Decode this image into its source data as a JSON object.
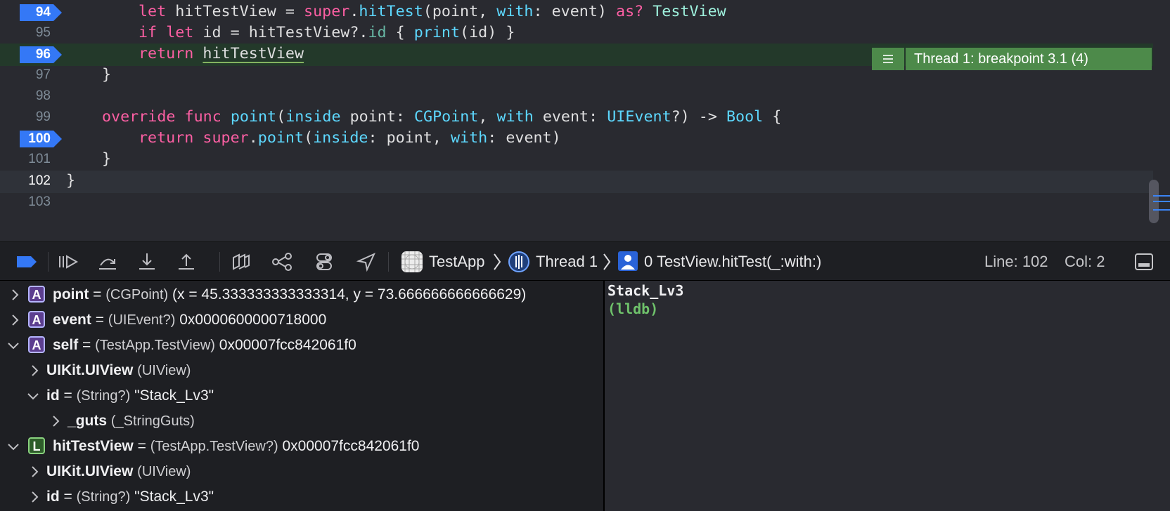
{
  "editor": {
    "lines": [
      {
        "num": "94",
        "breakpoint": true
      },
      {
        "num": "95",
        "breakpoint": false
      },
      {
        "num": "96",
        "breakpoint": true
      },
      {
        "num": "97",
        "breakpoint": false
      },
      {
        "num": "98",
        "breakpoint": false
      },
      {
        "num": "99",
        "breakpoint": false
      },
      {
        "num": "100",
        "breakpoint": true
      },
      {
        "num": "101",
        "breakpoint": false
      },
      {
        "num": "102",
        "breakpoint": false
      },
      {
        "num": "103",
        "breakpoint": false
      }
    ],
    "code": {
      "l94": {
        "t1": "let",
        "t2": " hitTestView = ",
        "t3": "super",
        "t4": ".",
        "t5": "hitTest",
        "t6": "(point, ",
        "t7": "with",
        "t8": ": event) ",
        "t9": "as?",
        "t10": " ",
        "t11": "TestView"
      },
      "l95": {
        "t1": "if",
        "t2": " ",
        "t3": "let",
        "t4": " id = hitTestView?.",
        "t5": "id",
        "t6": " { ",
        "t7": "print",
        "t8": "(id) }"
      },
      "l96": {
        "t1": "return",
        "t2": " ",
        "t3": "hitTestView"
      },
      "l97": {
        "t1": "}"
      },
      "l99": {
        "t1": "override",
        "t2": " ",
        "t3": "func",
        "t4": " ",
        "t5": "point",
        "t6": "(",
        "t7": "inside",
        "t8": " point: ",
        "t9": "CGPoint",
        "t10": ", ",
        "t11": "with",
        "t12": " event: ",
        "t13": "UIEvent",
        "t14": "?) -> ",
        "t15": "Bool",
        "t16": " {"
      },
      "l100": {
        "t1": "return",
        "t2": " ",
        "t3": "super",
        "t4": ".",
        "t5": "point",
        "t6": "(",
        "t7": "inside",
        "t8": ": point, ",
        "t9": "with",
        "t10": ": event)"
      },
      "l101": {
        "t1": "}"
      },
      "l102": {
        "t1": "}"
      }
    },
    "thread_banner": "Thread 1: breakpoint 3.1 (4)"
  },
  "debug_bar": {
    "crumb_app": "TestApp",
    "crumb_thread": "Thread 1",
    "crumb_frame": "0 TestView.hitTest(_:with:)",
    "line_label": "Line: 102",
    "col_label": "Col: 2"
  },
  "variables": [
    {
      "badge": "A",
      "name": "point",
      "sep": " = ",
      "type": "(CGPoint)",
      "value": " (x = 45.333333333333314, y = 73.666666666666629)"
    },
    {
      "badge": "A",
      "name": "event",
      "sep": " = ",
      "type": "(UIEvent?)",
      "value": " 0x0000600000718000"
    },
    {
      "badge": "A",
      "name": "self",
      "sep": " = ",
      "type": "(TestApp.TestView)",
      "value": " 0x00007fcc842061f0"
    },
    {
      "badge": "",
      "name": "UIKit.UIView",
      "sep": " ",
      "type": "(UIView)",
      "value": ""
    },
    {
      "badge": "",
      "name": "id",
      "sep": " = ",
      "type": "(String?)",
      "value": " \"Stack_Lv3\""
    },
    {
      "badge": "",
      "name": "_guts",
      "sep": " ",
      "type": "(_StringGuts)",
      "value": ""
    },
    {
      "badge": "L",
      "name": "hitTestView",
      "sep": " = ",
      "type": "(TestApp.TestView?)",
      "value": " 0x00007fcc842061f0"
    },
    {
      "badge": "",
      "name": "UIKit.UIView",
      "sep": " ",
      "type": "(UIView)",
      "value": ""
    },
    {
      "badge": "",
      "name": "id",
      "sep": " = ",
      "type": "(String?)",
      "value": " \"Stack_Lv3\""
    }
  ],
  "console": {
    "output": "Stack_Lv3",
    "prompt": "(lldb)"
  },
  "colors": {
    "breakpoint": "#3478f6",
    "paused_line": "#23392a",
    "thread_banner": "#4d8a4a",
    "lldb_prompt": "#6fc26b"
  }
}
